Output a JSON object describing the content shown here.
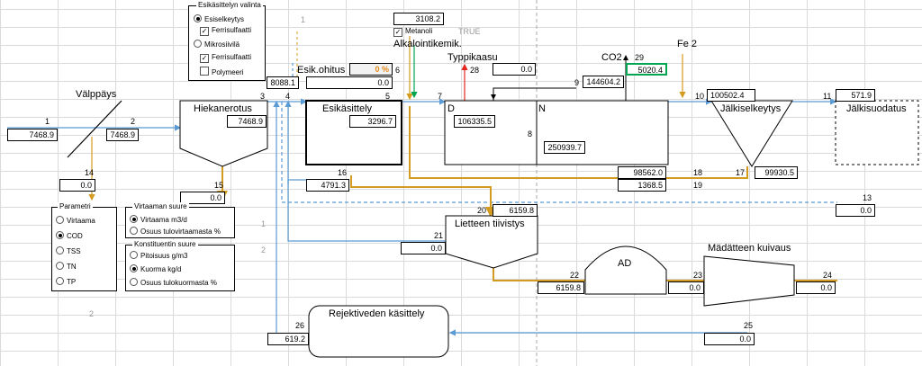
{
  "stream_numbers": {
    "s1": "1",
    "s2": "2",
    "s3": "3",
    "s4": "4",
    "s5": "5",
    "s6": "6",
    "s7": "7",
    "s8": "8",
    "s9": "9",
    "s10": "10",
    "s11": "11",
    "s13": "13",
    "s14": "14",
    "s15": "15",
    "s16": "16",
    "s17": "17",
    "s18": "18",
    "s19": "19",
    "s20": "20",
    "s21": "21",
    "s22": "22",
    "s23": "23",
    "s24": "24",
    "s25": "25",
    "s26": "26",
    "s28": "28",
    "s29": "29"
  },
  "values": {
    "v1": "7468.9",
    "v2": "7468.9",
    "v14": "0.0",
    "v15": "0.0",
    "v_hiekanerotus": "7468.9",
    "v4": "8088.1",
    "v_ohitus": "0.0",
    "v_esik": "3296.7",
    "v16": "4791.3",
    "v_methanol": "3108.2",
    "v_typpi": "0.0",
    "v_D": "106335.5",
    "v8": "250939.7",
    "v9": "144604.2",
    "v_co2": "5020.4",
    "v18": "98562.0",
    "v19": "1368.5",
    "v10": "100502.4",
    "v17": "99930.5",
    "v11": "571.9",
    "v13": "0.0",
    "v20": "6159.8",
    "v21": "0.0",
    "v22": "6159.8",
    "v23": "0.0",
    "v24": "0.0",
    "v25": "0.0",
    "v26": "619.2"
  },
  "labels": {
    "valippays": "Välppäys",
    "hiekanerotus": "Hiekanerotus",
    "esikasittely": "Esikäsittely",
    "esik_ohitus": "Esik.ohitus",
    "ohitus_pct": "0 %",
    "alkalointi": "Alkalointikemik.",
    "typpikaasu": "Typpikaasu",
    "co2": "CO2",
    "fe2": "Fe 2",
    "D": "D",
    "N": "N",
    "jalkiselkeytys": "Jälkiselkeytys",
    "jalkisuodatus": "Jälkisuodatus",
    "lietteen": "Lietteen tiivistys",
    "ad": "AD",
    "madatteen": "Mädätteen kuivaus",
    "rejektivesi": "Rejektiveden käsittely",
    "true_flag": "TRUE",
    "metanoli": "Metanoli",
    "row_1a": "1",
    "row_1b": "1",
    "row_2a": "2",
    "row_2b": "2"
  },
  "esikasittely_panel": {
    "title": "Esikäsittelyn valinta",
    "options": [
      "Esiselkeytys",
      "Ferrisulfaatti",
      "Mikrosiivilä",
      "Ferrisulfaatti",
      "Polymeeri"
    ]
  },
  "parametri_panel": {
    "title": "Parametri",
    "options": [
      "Virtaama",
      "COD",
      "TSS",
      "TN",
      "TP"
    ]
  },
  "virtaaman_panel": {
    "title": "Virtaaman suure",
    "options": [
      "Virtaama m3/d",
      "Osuus tulovirtaamasta %"
    ]
  },
  "konst_panel": {
    "title": "Konstituentin suure",
    "options": [
      "Pitoisuus g/m3",
      "Kuorma kg/d",
      "Osuus tulokuormasta %"
    ]
  },
  "colors": {
    "water": "#5b9bd5",
    "sludge": "#d39b1f",
    "gas": "#e0261e",
    "green": "#00a651",
    "grid": "#dadada"
  }
}
